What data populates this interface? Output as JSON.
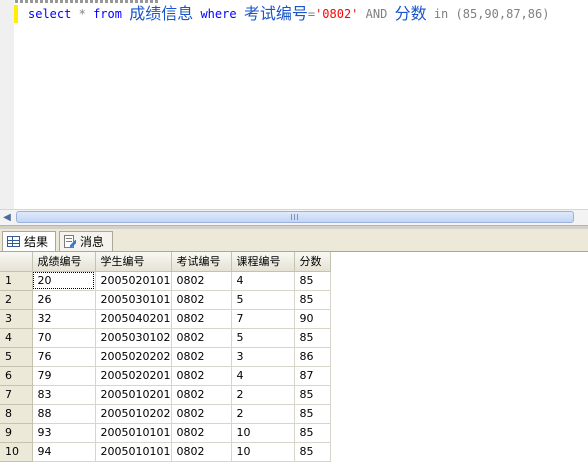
{
  "editor": {
    "sql": {
      "select": "select",
      "star": "*",
      "from": "from",
      "table": "成绩信息",
      "where": "where",
      "column1": "考试编号",
      "eq": "=",
      "value": "'0802'",
      "and": "AND",
      "column2": "分数",
      "in": "in",
      "list": "(85,90,87,86)"
    }
  },
  "tabs": [
    {
      "label": "结果",
      "icon": "grid-icon",
      "active": true
    },
    {
      "label": "消息",
      "icon": "message-icon",
      "active": false
    }
  ],
  "results": {
    "columns": [
      "成绩编号",
      "学生编号",
      "考试编号",
      "课程编号",
      "分数"
    ],
    "rows": [
      {
        "num": "1",
        "cells": [
          "20",
          "2005020101",
          "0802",
          "4",
          "85"
        ]
      },
      {
        "num": "2",
        "cells": [
          "26",
          "2005030101",
          "0802",
          "5",
          "85"
        ]
      },
      {
        "num": "3",
        "cells": [
          "32",
          "2005040201",
          "0802",
          "7",
          "90"
        ]
      },
      {
        "num": "4",
        "cells": [
          "70",
          "2005030102",
          "0802",
          "5",
          "85"
        ]
      },
      {
        "num": "5",
        "cells": [
          "76",
          "2005020202",
          "0802",
          "3",
          "86"
        ]
      },
      {
        "num": "6",
        "cells": [
          "79",
          "2005020201",
          "0802",
          "4",
          "87"
        ]
      },
      {
        "num": "7",
        "cells": [
          "83",
          "2005010201",
          "0802",
          "2",
          "85"
        ]
      },
      {
        "num": "8",
        "cells": [
          "88",
          "2005010202",
          "0802",
          "2",
          "85"
        ]
      },
      {
        "num": "9",
        "cells": [
          "93",
          "2005010101",
          "0802",
          "10",
          "85"
        ]
      },
      {
        "num": "10",
        "cells": [
          "94",
          "2005010101",
          "0802",
          "10",
          "85"
        ]
      }
    ]
  },
  "colors": {
    "keyword": "#0000ff",
    "operator": "#808080",
    "string": "#ff0000",
    "tab_background": "#ece9d8",
    "scroll_thumb": "#c3d5f5"
  }
}
